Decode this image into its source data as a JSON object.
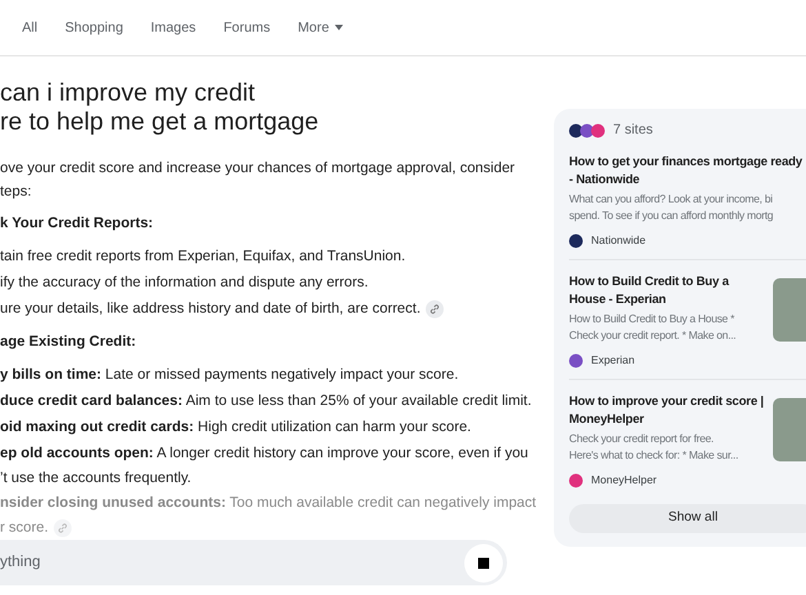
{
  "nav": {
    "tabs": [
      {
        "label": "All",
        "selected": false
      },
      {
        "label": "Shopping",
        "selected": false
      },
      {
        "label": "Images",
        "selected": false
      },
      {
        "label": "Forums",
        "selected": false
      }
    ],
    "more": "More"
  },
  "answer": {
    "title": [
      "can i improve my credit",
      "re to help me get a mortgage"
    ],
    "lines": [
      {
        "kind": "text",
        "text": "ove your credit score and increase your chances of mortgage approval, consider",
        "link": false,
        "faded": false
      },
      {
        "kind": "text",
        "text": "teps:",
        "link": false,
        "faded": false
      },
      {
        "kind": "heading",
        "text": "k Your Credit Reports:",
        "link": false,
        "faded": false
      },
      {
        "kind": "bullet",
        "text": "tain free credit reports from Experian, Equifax, and TransUnion.",
        "link": false,
        "faded": false
      },
      {
        "kind": "bullet",
        "text": "ify the accuracy of the information and dispute any errors.",
        "link": false,
        "faded": false
      },
      {
        "kind": "bullet",
        "text": "ure your details, like address history and date of birth, are correct.",
        "link": true,
        "faded": false
      },
      {
        "kind": "heading",
        "text": "age Existing Credit:",
        "link": false,
        "faded": false
      },
      {
        "kind": "bullet",
        "text": "**y bills on time:** Late or missed payments negatively impact your score.",
        "link": false,
        "faded": false
      },
      {
        "kind": "bullet",
        "text": "**duce credit card balances:** Aim to use less than 25% of your available credit limit.",
        "link": false,
        "faded": false
      },
      {
        "kind": "bullet",
        "text": "**oid maxing out credit cards:** High credit utilization can harm your score.",
        "link": false,
        "faded": false
      },
      {
        "kind": "bullet",
        "text": "**ep old accounts open:** A longer credit history can improve your score, even if you",
        "link": false,
        "faded": false
      },
      {
        "kind": "text",
        "text": "’t use the accounts frequently.",
        "link": false,
        "faded": false
      },
      {
        "kind": "bullet",
        "text": "**nsider closing unused accounts:** Too much available credit can negatively impact",
        "link": false,
        "faded": true
      },
      {
        "kind": "text",
        "text": "r score.",
        "link": true,
        "faded": true
      }
    ]
  },
  "ask": {
    "placeholder": "ything"
  },
  "sources": {
    "count": "7 sites",
    "items": [
      {
        "title": "How to get your finances mortgage ready - Nationwide",
        "snippet": [
          "What can you afford? Look at your income, bi",
          "spend. To see if you can afford monthly mortg"
        ],
        "site": "Nationwide",
        "color": "#1d2a5c",
        "thumb": false
      },
      {
        "title": "How to Build Credit to Buy a House - Experian",
        "snippet": [
          "How to Build Credit to Buy a House *",
          "Check your credit report. * Make on..."
        ],
        "site": "Experian",
        "color": "#7a4fc4",
        "thumb": true
      },
      {
        "title": "How to improve your credit score | MoneyHelper",
        "snippet": [
          "Check your credit report for free.",
          "Here's what to check for: * Make sur..."
        ],
        "site": "MoneyHelper",
        "color": "#e0317e",
        "thumb": true
      }
    ],
    "show_all": "Show all"
  }
}
